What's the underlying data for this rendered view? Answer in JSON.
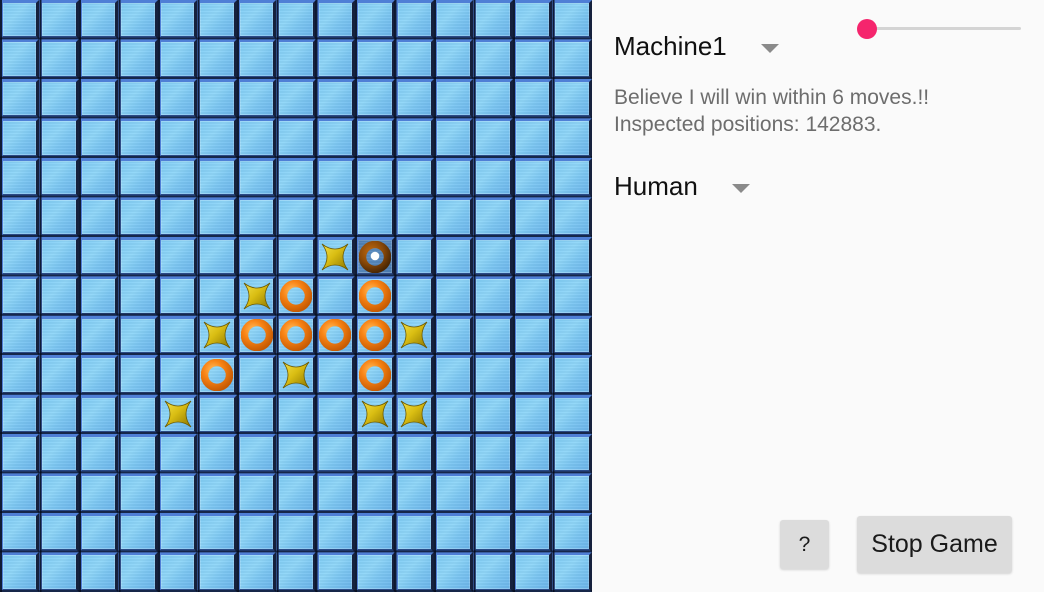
{
  "window": {
    "background_color": "#fafafa"
  },
  "board": {
    "name": "gomoku-board",
    "columns": 15,
    "rows": 15,
    "cell_size_px": 39.4667,
    "tile_color": "#7ecbf5",
    "grid_line_color": "#0a1426",
    "x_piece_color": "#d4b400",
    "o_piece_color": "#f58220",
    "last_move_highlight_color": "#4d7fb5",
    "pieces": [
      {
        "row": 6,
        "col": 8,
        "mark": "X",
        "last": false
      },
      {
        "row": 6,
        "col": 9,
        "mark": "O",
        "last": true
      },
      {
        "row": 7,
        "col": 6,
        "mark": "X",
        "last": false
      },
      {
        "row": 7,
        "col": 7,
        "mark": "O",
        "last": false
      },
      {
        "row": 7,
        "col": 9,
        "mark": "O",
        "last": false
      },
      {
        "row": 8,
        "col": 5,
        "mark": "X",
        "last": false
      },
      {
        "row": 8,
        "col": 6,
        "mark": "O",
        "last": false
      },
      {
        "row": 8,
        "col": 7,
        "mark": "O",
        "last": false
      },
      {
        "row": 8,
        "col": 8,
        "mark": "O",
        "last": false
      },
      {
        "row": 8,
        "col": 9,
        "mark": "O",
        "last": false
      },
      {
        "row": 8,
        "col": 10,
        "mark": "X",
        "last": false
      },
      {
        "row": 9,
        "col": 5,
        "mark": "O",
        "last": false
      },
      {
        "row": 9,
        "col": 7,
        "mark": "X",
        "last": false
      },
      {
        "row": 9,
        "col": 9,
        "mark": "O",
        "last": false
      },
      {
        "row": 10,
        "col": 4,
        "mark": "X",
        "last": false
      },
      {
        "row": 10,
        "col": 9,
        "mark": "X",
        "last": false
      },
      {
        "row": 10,
        "col": 10,
        "mark": "X",
        "last": false
      }
    ]
  },
  "panel": {
    "player_one": {
      "selected": "Machine1",
      "dropdown_icon": "chevron-down-icon"
    },
    "player_two": {
      "selected": "Human",
      "dropdown_icon": "chevron-down-icon"
    },
    "difficulty_slider": {
      "value_fraction": 0.0,
      "thumb_color": "#f5256d",
      "track_color": "#d4d4d4"
    },
    "status": {
      "line1": "Believe I will win within 6 moves.!!",
      "line2": "Inspected positions: 142883."
    },
    "buttons": {
      "help_label": "?",
      "stop_label": "Stop Game"
    }
  }
}
